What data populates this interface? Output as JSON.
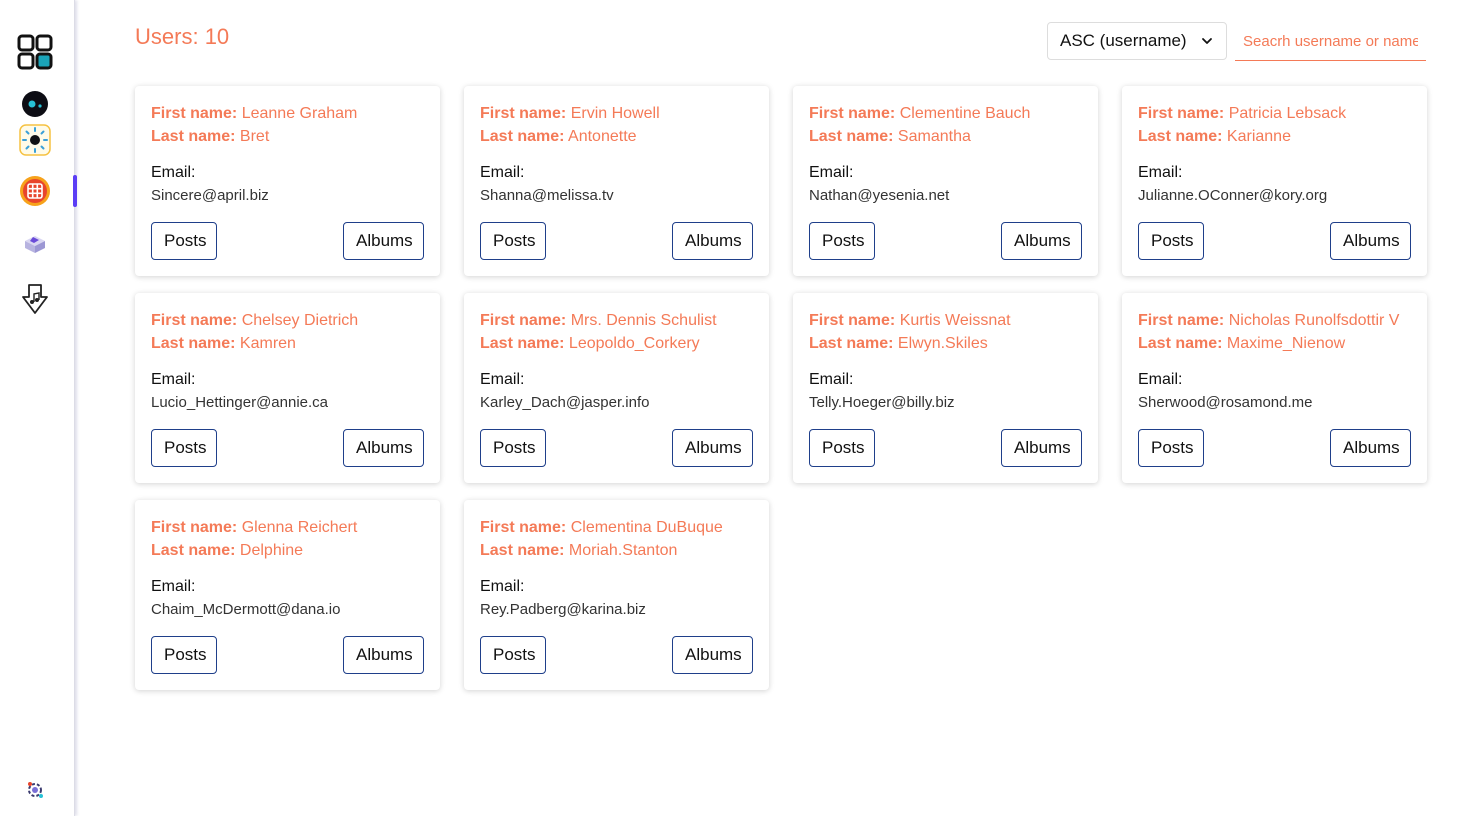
{
  "header": {
    "users_label": "Users:",
    "users_count": "10",
    "sort_selected": "ASC (username)",
    "search_placeholder": "Seacrh username or name"
  },
  "labels": {
    "first_name": "First name:",
    "last_name": "Last name:",
    "email": "Email:",
    "posts_button": "Posts",
    "albums_button": "Albums"
  },
  "users": [
    {
      "first": "Leanne Graham",
      "last": "Bret",
      "email": "Sincere@april.biz"
    },
    {
      "first": "Ervin Howell",
      "last": "Antonette",
      "email": "Shanna@melissa.tv"
    },
    {
      "first": "Clementine Bauch",
      "last": "Samantha",
      "email": "Nathan@yesenia.net"
    },
    {
      "first": "Patricia Lebsack",
      "last": "Karianne",
      "email": "Julianne.OConner@kory.org"
    },
    {
      "first": "Chelsey Dietrich",
      "last": "Kamren",
      "email": "Lucio_Hettinger@annie.ca"
    },
    {
      "first": "Mrs. Dennis Schulist",
      "last": "Leopoldo_Corkery",
      "email": "Karley_Dach@jasper.info"
    },
    {
      "first": "Kurtis Weissnat",
      "last": "Elwyn.Skiles",
      "email": "Telly.Hoeger@billy.biz"
    },
    {
      "first": "Nicholas Runolfsdottir V",
      "last": "Maxime_Nienow",
      "email": "Sherwood@rosamond.me"
    },
    {
      "first": "Glenna Reichert",
      "last": "Delphine",
      "email": "Chaim_McDermott@dana.io"
    },
    {
      "first": "Clementina DuBuque",
      "last": "Moriah.Stanton",
      "email": "Rey.Padberg@karina.biz"
    }
  ],
  "sidebar": {
    "icons": [
      "dashboard-grid-icon",
      "dot-circle-icon",
      "sun-gear-icon",
      "grid-app-icon",
      "cube-icon",
      "music-download-icon",
      "settings-bot-icon"
    ]
  },
  "colors": {
    "accent": "#f47a57",
    "button_border": "#1f3f8a",
    "active_marker": "#5b3df5"
  }
}
